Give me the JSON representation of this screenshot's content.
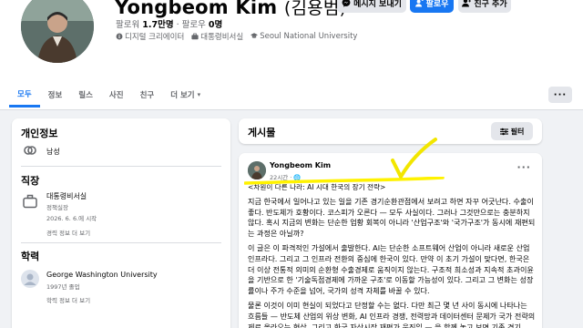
{
  "profile": {
    "name": "Yongbeom Kim",
    "name_native": "(김용범)",
    "followers_label": "팔로워",
    "followers_count": "1.7만명",
    "following_label": "팔로우",
    "following_count": "0명",
    "role": "디지털 크리에이터",
    "position": "대통령비서실",
    "school": "Seoul National University"
  },
  "actions": {
    "message": "메시지 보내기",
    "follow": "팔로우",
    "add_friend": "친구 추가"
  },
  "tabs": [
    "모두",
    "정보",
    "릴스",
    "사진",
    "친구",
    "더 보기"
  ],
  "intro": {
    "title": "개인정보",
    "gender": "남성",
    "work_title": "직장",
    "work_org": "대통령비서실",
    "work_role": "정책실장",
    "work_date": "2026. 6. 6.에 시작",
    "work_history": "경력 정보 더 보기",
    "edu_title": "학력",
    "edu_school": "George Washington University",
    "edu_year": "1997년 졸업",
    "edu_history": "학력 정보 더 보기"
  },
  "posts": {
    "title": "게시물",
    "filter": "필터",
    "author": "Yongbeom Kim",
    "time": "22시간 · 🌐",
    "headline": "<차원이 다른 나라: AI 시대 한국의 장기 전략>",
    "para1": "지금 한국에서 일어나고 있는 일을 기존 경기순환관점에서 보려고 하면 자꾸 어긋난다. 수출이 좋다. 반도체가 호황이다. 코스피가 오른다 — 모두 사실이다. 그러나 그것만으로는 충분하지 않다. 혹시 지금의 변화는 단순한 업황 회복이 아니라 '산업구조'와 '국가구조'가 동시에 재편되는 과정은 아닐까?",
    "para2": "이 글은 이 파격적인 가설에서 출발한다. AI는 단순한 소프트웨어 산업이 아니라 새로운 산업인프라다. 그리고 그 인프라 전환의 중심에 한국이 있다. 만약 이 초기 가설이 맞다면, 한국은 더 이상 전통적 의미의 순환형 수출경제로 움직이지 않는다. 구조적 희소성과 지속적 초과이윤을 기반으로 한 '기술독점경제에 가까운 구조'로 이동할 가능성이 있다. 그리고 그 변화는 성장률이나 주가 수준을 넘어, 국가의 성격 자체를 바꿀 수 있다.",
    "para3": "물론 이것이 이미 현실이 되었다고 단정할 수는 없다. 다만 최근 몇 년 사이 동시에 나타나는 흐름들 — 반도체 산업의 위상 변화, AI 인프라 경쟁, 전력망과 데이터센터 문제가 국가 전략의제로 올라오는 현상, 그리고 한국 자산시장 재평가 움직임 — 을 함께 놓고 보면 기존 경기"
  },
  "colors": {
    "accent": "#1877f2",
    "highlight": "#fff200",
    "checkmark": "#f2e600"
  }
}
